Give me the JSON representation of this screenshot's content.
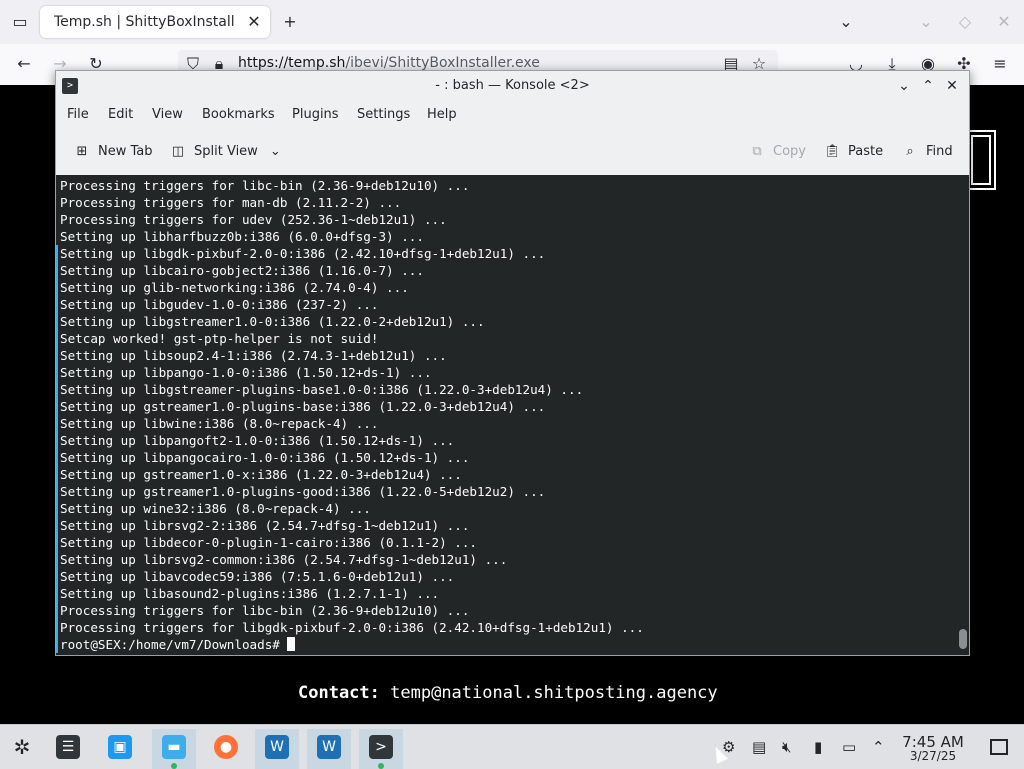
{
  "browser": {
    "tab_title": "Temp.sh | ShittyBoxInstaller.e",
    "url_host": "https://temp.sh",
    "url_path": "/ibevi/ShittyBoxInstaller.exe"
  },
  "page": {
    "contact_label": "Contact:",
    "contact_email": "temp@national.shitposting.agency"
  },
  "konsole": {
    "title": "- : bash — Konsole <2>",
    "menu": [
      "File",
      "Edit",
      "View",
      "Bookmarks",
      "Plugins",
      "Settings",
      "Help"
    ],
    "toolbar": {
      "new_tab": "New Tab",
      "split_view": "Split View",
      "copy": "Copy",
      "paste": "Paste",
      "find": "Find"
    },
    "terminal_lines": [
      "Processing triggers for libc-bin (2.36-9+deb12u10) ...",
      "Processing triggers for man-db (2.11.2-2) ...",
      "Processing triggers for udev (252.36-1~deb12u1) ...",
      "Setting up libharfbuzz0b:i386 (6.0.0+dfsg-3) ...",
      "Setting up libgdk-pixbuf-2.0-0:i386 (2.42.10+dfsg-1+deb12u1) ...",
      "Setting up libcairo-gobject2:i386 (1.16.0-7) ...",
      "Setting up glib-networking:i386 (2.74.0-4) ...",
      "Setting up libgudev-1.0-0:i386 (237-2) ...",
      "Setting up libgstreamer1.0-0:i386 (1.22.0-2+deb12u1) ...",
      "Setcap worked! gst-ptp-helper is not suid!",
      "Setting up libsoup2.4-1:i386 (2.74.3-1+deb12u1) ...",
      "Setting up libpango-1.0-0:i386 (1.50.12+ds-1) ...",
      "Setting up libgstreamer-plugins-base1.0-0:i386 (1.22.0-3+deb12u4) ...",
      "Setting up gstreamer1.0-plugins-base:i386 (1.22.0-3+deb12u4) ...",
      "Setting up libwine:i386 (8.0~repack-4) ...",
      "Setting up libpangoft2-1.0-0:i386 (1.50.12+ds-1) ...",
      "Setting up libpangocairo-1.0-0:i386 (1.50.12+ds-1) ...",
      "Setting up gstreamer1.0-x:i386 (1.22.0-3+deb12u4) ...",
      "Setting up gstreamer1.0-plugins-good:i386 (1.22.0-5+deb12u2) ...",
      "Setting up wine32:i386 (8.0~repack-4) ...",
      "Setting up librsvg2-2:i386 (2.54.7+dfsg-1~deb12u1) ...",
      "Setting up libdecor-0-plugin-1-cairo:i386 (0.1.1-2) ...",
      "Setting up librsvg2-common:i386 (2.54.7+dfsg-1~deb12u1) ...",
      "Setting up libavcodec59:i386 (7:5.1.6-0+deb12u1) ...",
      "Setting up libasound2-plugins:i386 (1.2.7.1-1) ...",
      "Processing triggers for libc-bin (2.36-9+deb12u10) ...",
      "Processing triggers for libgdk-pixbuf-2.0-0:i386 (2.42.10+dfsg-1+deb12u1) ..."
    ],
    "prompt": "root@SEX:/home/vm7/Downloads# "
  },
  "taskbar": {
    "clock_time": "7:45 AM",
    "clock_date": "3/27/25"
  },
  "colors": {
    "terminal_bg": "#232627",
    "terminal_fg": "#fcfcfc",
    "accent": "#3daee9",
    "window_bg": "#eff0f1"
  },
  "icons": [
    "list-all-tabs-icon",
    "new-tab-icon",
    "back-icon",
    "forward-icon",
    "reload-icon",
    "shield-icon",
    "lock-icon",
    "reader-view-icon",
    "bookmark-star-icon",
    "pocket-icon",
    "downloads-icon",
    "account-icon",
    "extensions-icon",
    "menu-icon",
    "terminal-icon",
    "search-icon",
    "paste-icon",
    "copy-icon",
    "split-view-icon",
    "new-tab-icon",
    "kde-launcher-icon",
    "system-settings-icon",
    "discover-store-icon",
    "dolphin-files-icon",
    "firefox-icon",
    "wine-icon",
    "konsole-icon",
    "volume-muted-icon",
    "network-icon",
    "battery-icon",
    "clipboard-icon",
    "tray-expand-icon",
    "show-desktop-icon"
  ]
}
